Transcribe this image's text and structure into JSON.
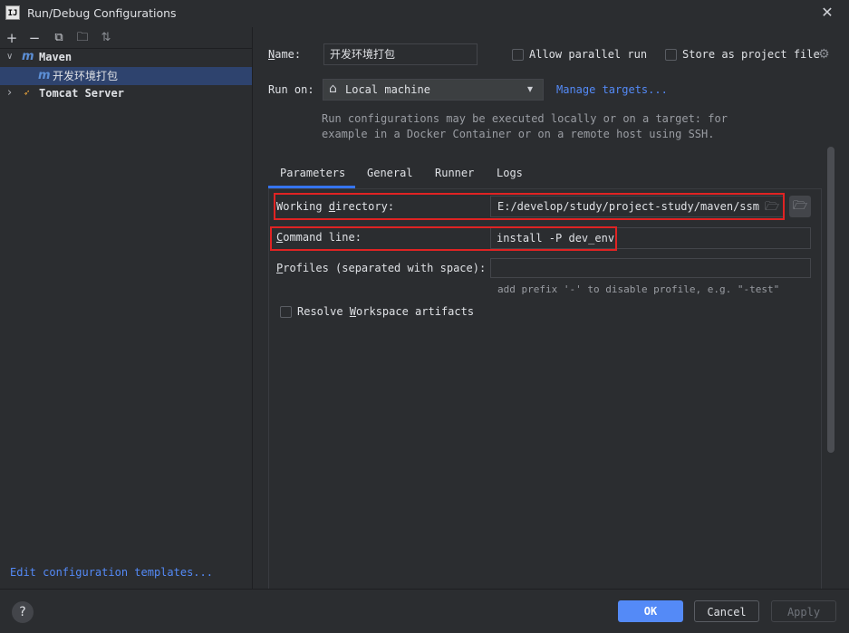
{
  "window": {
    "app_icon": "IJ",
    "title": "Run/Debug Configurations",
    "close_glyph": "✕"
  },
  "toolbar": {
    "add": "+",
    "remove": "−",
    "copy": "⧉",
    "new_folder": "🗀",
    "sort": "⇅"
  },
  "tree": {
    "maven_label": "Maven",
    "maven_child_label": "开发环境打包",
    "tomcat_label": "Tomcat Server",
    "chevron_open": "∨",
    "chevron_closed": "›",
    "maven_icon_glyph": "m",
    "tomcat_icon_glyph": "➶"
  },
  "edit_templates_link": "Edit configuration templates...",
  "form": {
    "name_label": "Name:",
    "name_value": "开发环境打包",
    "allow_parallel_label": "Allow parallel run",
    "store_label": "Store as project file",
    "gear_glyph": "⚙",
    "run_on_label": "Run on:",
    "run_on_value": "Local machine",
    "home_glyph": "⌂",
    "dropdown_glyph": "▾",
    "manage_targets": "Manage targets...",
    "hint_line1": "Run configurations may be executed locally or on a target: for",
    "hint_line2": "example in a Docker Container or on a remote host using SSH."
  },
  "tabs": [
    "Parameters",
    "General",
    "Runner",
    "Logs"
  ],
  "parameters": {
    "working_dir_label": "Working directory:",
    "working_dir_value": "E:/develop/study/project-study/maven/ssm",
    "folder_glyph": "🗁",
    "command_line_label": "Command line:",
    "command_line_value": "install -P dev_env",
    "profiles_label": "Profiles (separated with space):",
    "profiles_value": "",
    "profiles_hint": "add prefix '-' to disable profile, e.g. \"-test\"",
    "resolve_workspace_label": "Resolve Workspace artifacts"
  },
  "buttons": {
    "help": "?",
    "ok": "OK",
    "cancel": "Cancel",
    "apply": "Apply"
  },
  "colors": {
    "background": "#2b2d30",
    "accent": "#548af7",
    "selection": "#2e436e",
    "highlight_box": "#e02323"
  }
}
